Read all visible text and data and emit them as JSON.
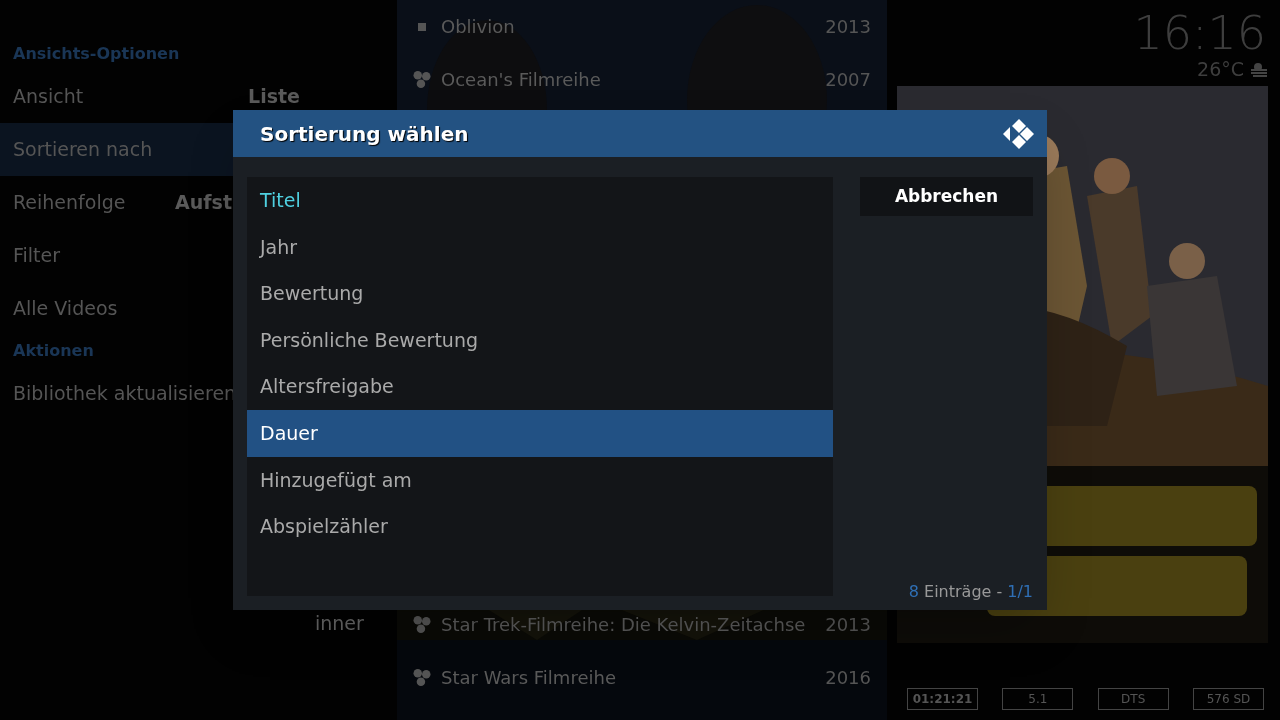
{
  "options_panel": {
    "sections": [
      {
        "heading": "Ansichts-Optionen",
        "items": [
          {
            "label": "Ansicht",
            "value": "Liste",
            "selected": false
          },
          {
            "label": "Sortieren nach",
            "selected": true
          },
          {
            "label": "Reihenfolge",
            "value": "Aufst",
            "selected": false
          },
          {
            "label": "Filter",
            "selected": false
          },
          {
            "label": "Alle Videos",
            "selected": false
          }
        ]
      },
      {
        "heading": "Aktionen",
        "items": [
          {
            "label": "Bibliothek aktualisieren",
            "selected": false
          }
        ]
      }
    ],
    "overflow_text": "inner"
  },
  "media_list": {
    "top_rows": [
      {
        "kind": "movie",
        "title": "Oblivion",
        "year": "2013"
      },
      {
        "kind": "set",
        "title": "Ocean's Filmreihe",
        "year": "2007"
      }
    ],
    "bottom_rows": [
      {
        "kind": "set",
        "title": "Star Trek-Filmreihe: Die Kelvin-Zeitachse",
        "year": "2013"
      },
      {
        "kind": "set",
        "title": "Star Wars Filmreihe",
        "year": "2016"
      }
    ]
  },
  "clock": "16:16",
  "weather": {
    "temperature": "26°C"
  },
  "info_badges": [
    "01:21:21",
    "5.1",
    "DTS",
    "576 SD"
  ],
  "dialog": {
    "title": "Sortierung wählen",
    "items": [
      {
        "label": "Titel",
        "current": true,
        "selected": false
      },
      {
        "label": "Jahr",
        "current": false,
        "selected": false
      },
      {
        "label": "Bewertung",
        "current": false,
        "selected": false
      },
      {
        "label": "Persönliche Bewertung",
        "current": false,
        "selected": false
      },
      {
        "label": "Altersfreigabe",
        "current": false,
        "selected": false
      },
      {
        "label": "Dauer",
        "current": false,
        "selected": true
      },
      {
        "label": "Hinzugefügt am",
        "current": false,
        "selected": false
      },
      {
        "label": "Abspielzähler",
        "current": false,
        "selected": false
      }
    ],
    "cancel_button": "Abbrechen",
    "count": "8",
    "count_label": "Einträge -",
    "page": "1/1"
  }
}
